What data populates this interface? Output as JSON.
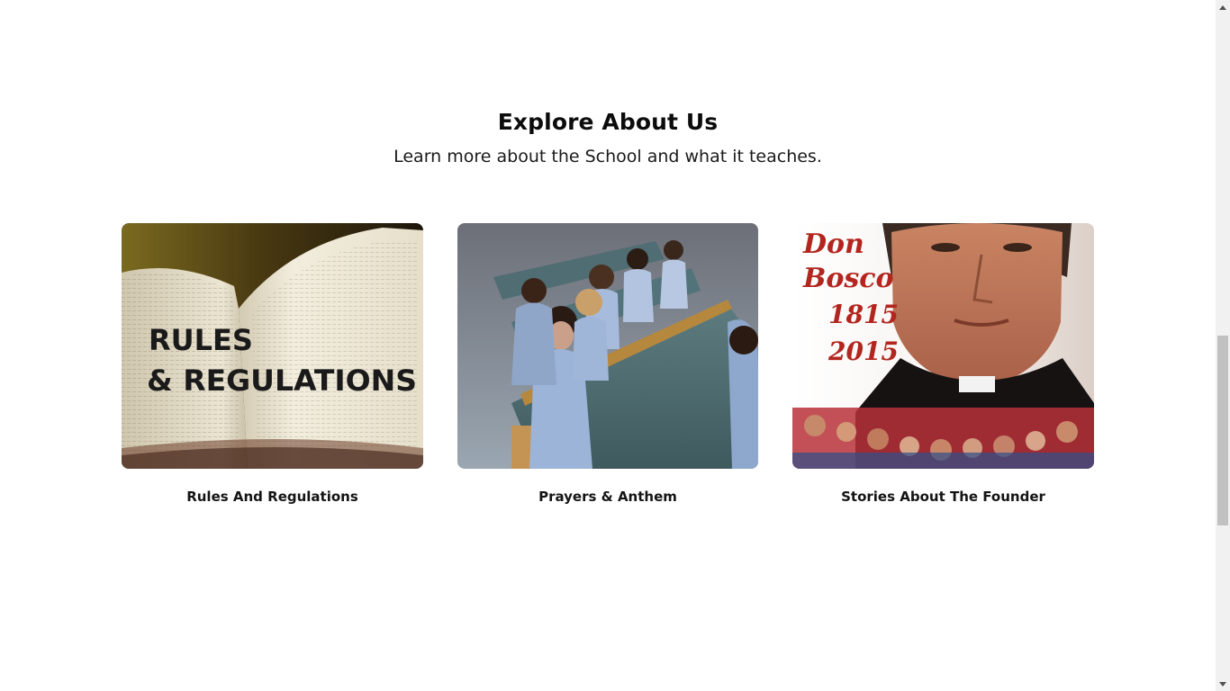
{
  "section": {
    "title": "Explore About Us",
    "subtitle": "Learn more about the School and what it teaches."
  },
  "cards": [
    {
      "label": "Rules And Regulations",
      "image_text_line1": "RULES",
      "image_text_line2": "& REGULATIONS"
    },
    {
      "label": "Prayers & Anthem"
    },
    {
      "label": "Stories About The Founder",
      "image_text_line1": "Don",
      "image_text_line2": "Bosco",
      "image_text_line3": "1815",
      "image_text_line4": "2015"
    }
  ],
  "scrollbar": {
    "up_icon": "triangle-up-icon",
    "down_icon": "triangle-down-icon",
    "position_fraction": 0.65
  },
  "colors": {
    "background": "#ffffff",
    "title": "#0c0c0c",
    "label": "#141414",
    "handwriting_red": "#b2261f"
  }
}
